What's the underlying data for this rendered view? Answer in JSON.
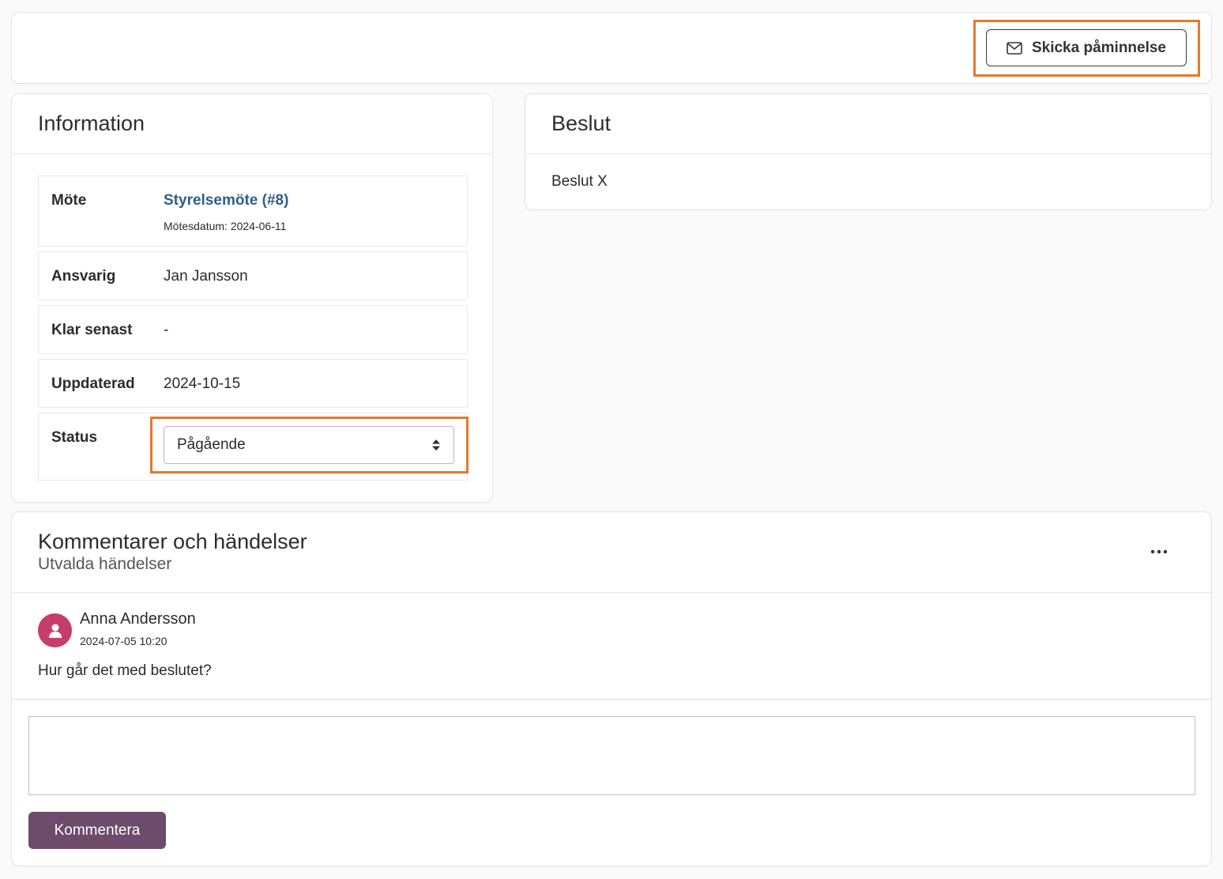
{
  "toolbar": {
    "reminder_label": "Skicka påminnelse",
    "reminder_icon": "envelope-icon"
  },
  "information": {
    "title": "Information",
    "meeting": {
      "label": "Möte",
      "link": "Styrelsemöte (#8)",
      "date_text": "Mötesdatum: 2024-06-11"
    },
    "responsible": {
      "label": "Ansvarig",
      "value": "Jan Jansson"
    },
    "due": {
      "label": "Klar senast",
      "value": "-"
    },
    "updated": {
      "label": "Uppdaterad",
      "value": "2024-10-15"
    },
    "status": {
      "label": "Status",
      "selected": "Pågående"
    }
  },
  "decision": {
    "title": "Beslut",
    "text": "Beslut X"
  },
  "comments": {
    "title": "Kommentarer och händelser",
    "subtitle": "Utvalda händelser",
    "items": [
      {
        "author": "Anna Andersson",
        "time": "2024-07-05 10:20",
        "text": "Hur går det med beslutet?",
        "avatar_color": "#c63d6b"
      }
    ],
    "input_placeholder": "",
    "submit_label": "Kommentera"
  },
  "colors": {
    "highlight": "#e8772e",
    "link": "#2e5f86",
    "primary_button": "#6d4c6b"
  }
}
